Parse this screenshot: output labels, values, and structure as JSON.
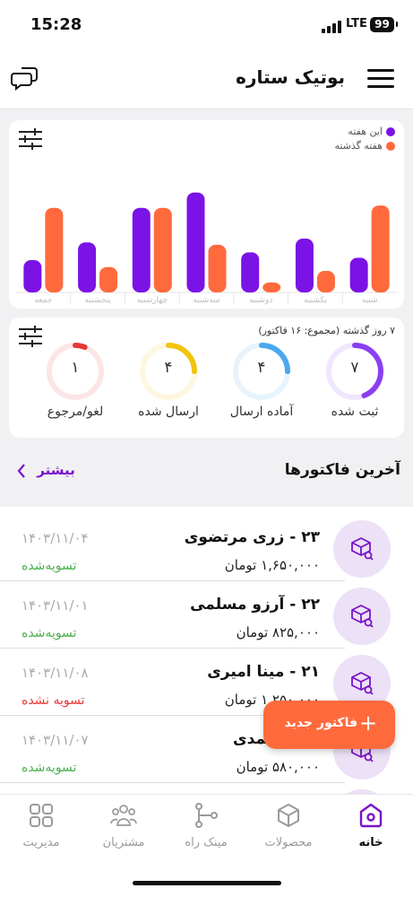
{
  "status_bar": {
    "time": "15:28",
    "network": "LTE",
    "battery": "99"
  },
  "header": {
    "title": "بوتیک ستاره"
  },
  "chart_data": {
    "type": "bar",
    "categories": [
      "جمعه",
      "پنجشنبه",
      "چهارشنبه",
      "سه‌شنبه",
      "دوشنبه",
      "یکشنبه",
      "شنبه"
    ],
    "series": [
      {
        "name": "این هفته",
        "color": "#7b12e6",
        "values": [
          42,
          65,
          110,
          130,
          52,
          70,
          45
        ]
      },
      {
        "name": "هفته گذشته",
        "color": "#ff6a3d",
        "values": [
          110,
          33,
          110,
          62,
          13,
          28,
          113
        ]
      }
    ],
    "ylim": [
      0,
      140
    ],
    "legend_position": "top-right",
    "grid": false
  },
  "stats": {
    "period_label": "۷ روز گذشته (مجموع: ۱۶ فاکتور)",
    "items": [
      {
        "value": "۷",
        "label": "ثبت شده",
        "color": "#8a3ff0",
        "fraction": 0.44
      },
      {
        "value": "۴",
        "label": "آماده ارسال",
        "color": "#4aa8f0",
        "fraction": 0.25
      },
      {
        "value": "۴",
        "label": "ارسال شده",
        "color": "#f1c40f",
        "fraction": 0.25
      },
      {
        "value": "۱",
        "label": "لغو/مرجوع",
        "color": "#e53935",
        "fraction": 0.06
      }
    ]
  },
  "invoices": {
    "title": "آخرین فاکتورها",
    "more_label": "بیشتر",
    "rows": [
      {
        "name": "۲۳ - زری مرتضوی",
        "amount": "۱,۶۵۰,۰۰۰ تومان",
        "date": "۱۴۰۳/۱۱/۰۴",
        "status": "تسویه‌شده",
        "status_color": "#4caf50"
      },
      {
        "name": "۲۲ - آرزو مسلمی",
        "amount": "۸۲۵,۰۰۰ تومان",
        "date": "۱۴۰۳/۱۱/۰۱",
        "status": "تسویه‌شده",
        "status_color": "#4caf50"
      },
      {
        "name": "۲۱ - مینا امیری",
        "amount": "۱,۲۵۰,۰۰۰ تومان",
        "date": "۱۴۰۳/۱۱/۰۸",
        "status": "تسویه‌ نشده",
        "status_color": "#e53935"
      },
      {
        "name": "رین محمدی",
        "amount": "۵۸۰,۰۰۰ تومان",
        "date": "۱۴۰۳/۱۱/۰۷",
        "status": "تسویه‌شده",
        "status_color": "#4caf50"
      }
    ]
  },
  "fab": {
    "label": "فاکتور جدید"
  },
  "nav": {
    "items": [
      {
        "label": "خانه",
        "icon": "home-icon",
        "active": true
      },
      {
        "label": "محصولات",
        "icon": "box-icon",
        "active": false
      },
      {
        "label": "مینک راه",
        "icon": "share-nodes-icon",
        "active": false
      },
      {
        "label": "مشتریان",
        "icon": "users-icon",
        "active": false
      },
      {
        "label": "مدیریت",
        "icon": "grid-icon",
        "active": false
      }
    ]
  }
}
